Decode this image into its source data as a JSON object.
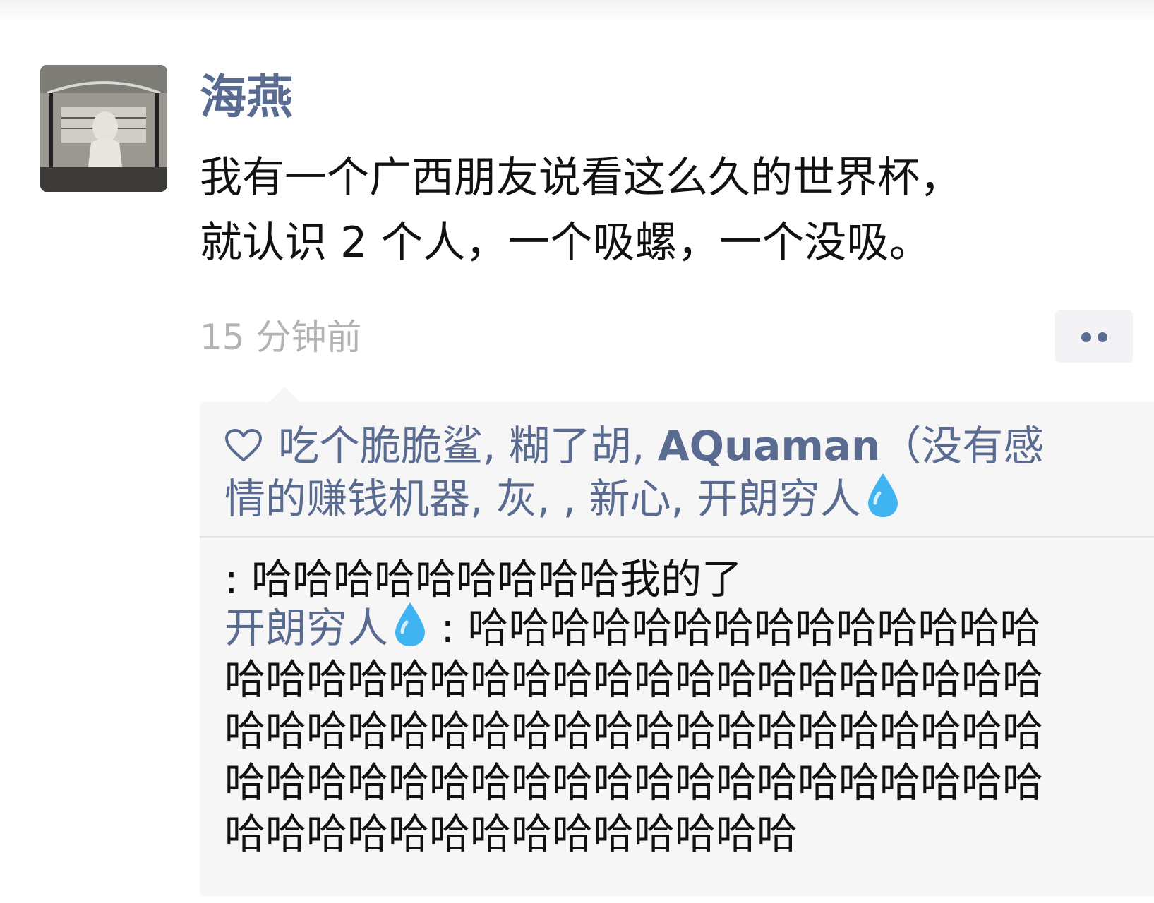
{
  "post": {
    "author": "海燕",
    "content_line_1": "我有一个广西朋友说看这么久的世界杯，",
    "content_line_2": "就认识 2 个人，一个吸螺，一个没吸。",
    "timestamp": "15 分钟前"
  },
  "likes": {
    "icon": "heart-icon",
    "names_1": "吃个脆脆鲨, 糊了胡, ",
    "name_aquaman": "AQuaman",
    "names_1_tail": "（没有感",
    "names_2": "情的赚钱机器, 灰, , 新心, 开朗穷人",
    "names_2_icon": "water-drop-icon"
  },
  "comments": [
    {
      "author": "",
      "text": ": 哈哈哈哈哈哈哈哈哈我的了"
    },
    {
      "author": "开朗穷人",
      "author_icon": "water-drop-icon",
      "separator": " : ",
      "line_1": "哈哈哈哈哈哈哈哈哈哈哈哈哈哈",
      "line_2": "哈哈哈哈哈哈哈哈哈哈哈哈哈哈哈哈哈哈哈哈",
      "line_3": "哈哈哈哈哈哈哈哈哈哈哈哈哈哈哈哈哈哈哈哈",
      "line_4": "哈哈哈哈哈哈哈哈哈哈哈哈哈哈哈哈哈哈哈哈",
      "line_5": "哈哈哈哈哈哈哈哈哈哈哈哈哈哈"
    }
  ],
  "colors": {
    "name_link": "#5a6b91",
    "timestamp": "#b3b3b3",
    "panel_bg": "#f6f6f6",
    "drop": "#3fb4f0"
  }
}
